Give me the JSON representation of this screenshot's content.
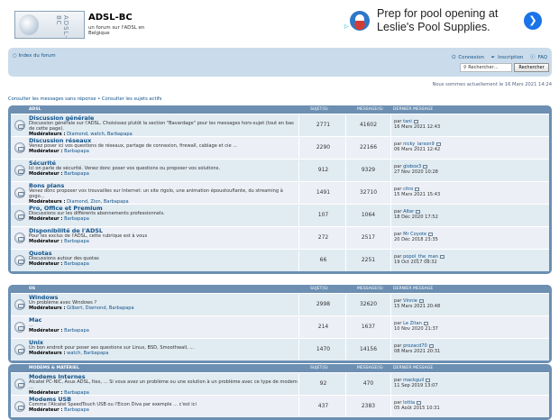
{
  "header": {
    "logo_text": "ADSL-BC",
    "site_title": "ADSL-BC",
    "site_desc": "un forum sur l'ADSL en Belgique"
  },
  "ad": {
    "text": "Prep for pool opening at Leslie's Pool Supplies.",
    "arrow_icon": "chevron-right-icon",
    "brand_color": "#1a73e8"
  },
  "nav": {
    "index": "Index du forum",
    "login": "Connexion",
    "register": "Inscription",
    "faq": "FAQ",
    "search_placeholder": "Rechercher…",
    "search_button": "Rechercher"
  },
  "datetime": "Nous sommes actuellement le 16 Mars 2021 14:24",
  "quicklinks": "Consulter les messages sans réponse • Consulter les sujets actifs",
  "columns": {
    "topics": "SUJET(S)",
    "posts": "MESSAGE(S)",
    "last": "DERNIER MESSAGE"
  },
  "categories": [
    {
      "name": "ADSL",
      "forums": [
        {
          "title": "Discussion générale",
          "desc": "Discussion générale sur l'ADSL. Choisissez plutôt la section \"Bavardage\" pour les messages hors-sujet (tout en bas de cette page).",
          "mods_label": "Modérateurs :",
          "mods": "Diamond, watch, Barbapapa",
          "topics": "2771",
          "posts": "41602",
          "last_by": "par",
          "last_user": "tani",
          "last_date": "16 Mars 2021 12:43"
        },
        {
          "title": "Discussion réseaux",
          "desc": "Venez poser ici vos questions de réseaux, partage de connexion, firewall, cablage et cie ...",
          "mods_label": "Modérateur :",
          "mods": "Barbapapa",
          "topics": "2290",
          "posts": "22166",
          "last_by": "par",
          "last_user": "nicky_larson9",
          "last_date": "06 Mars 2021 12:42"
        },
        {
          "title": "Sécurité",
          "desc": "Ici on parle de sécurité. Venez donc poser vos questions ou proposer vos solutions.",
          "mods_label": "Modérateur :",
          "mods": "Barbapapa",
          "topics": "912",
          "posts": "9329",
          "last_by": "par",
          "last_user": "globox3",
          "last_date": "27 Nov 2020 10:28"
        },
        {
          "title": "Bons plans",
          "desc": "Venez donc proposer vos trouvailles sur Internet: un site rigolo, une animation époustouflante, du streaming à gogo...",
          "mods_label": "Modérateurs :",
          "mods": "Diamond, Zion, Barbapapa",
          "topics": "1491",
          "posts": "32710",
          "last_by": "par",
          "last_user": "citro",
          "last_date": "15 Mars 2021 15:43"
        },
        {
          "title": "Pro, Office et Premium",
          "desc": "Discussions sur les différents abonnements professionnels.",
          "mods_label": "Modérateur :",
          "mods": "Barbapapa",
          "topics": "107",
          "posts": "1064",
          "last_by": "par",
          "last_user": "Alter",
          "last_date": "18 Déc 2020 17:52"
        },
        {
          "title": "Disponibilité de l'ADSL",
          "desc": "Pour les exclus de l'ADSL, cette rubrique est à vous",
          "mods_label": "Modérateur :",
          "mods": "Barbapapa",
          "topics": "272",
          "posts": "2517",
          "last_by": "par",
          "last_user": "Mr Coyote",
          "last_date": "20 Déc 2018 23:35"
        },
        {
          "title": "Quotas",
          "desc": "Discussions autour des quotas",
          "mods_label": "Modérateur :",
          "mods": "Barbapapa",
          "topics": "66",
          "posts": "2251",
          "last_by": "par",
          "last_user": "popol_the_man",
          "last_date": "19 Oct 2017 08:32"
        }
      ]
    },
    {
      "name": "OS",
      "forums": [
        {
          "title": "Windows",
          "desc": "Un problème avec Windows ?",
          "mods_label": "Modérateurs :",
          "mods": "Gilbert, Diamond, Barbapapa",
          "topics": "2998",
          "posts": "32620",
          "last_by": "par",
          "last_user": "Vinnie",
          "last_date": "15 Mars 2021 20:48"
        },
        {
          "title": "Mac",
          "desc": "...",
          "mods_label": "Modérateur :",
          "mods": "Barbapapa",
          "topics": "214",
          "posts": "1637",
          "last_by": "par",
          "last_user": "Le Zitan",
          "last_date": "10 Nov 2020 21:37"
        },
        {
          "title": "Unix",
          "desc": "Un bon endroit pour poser ses questions sur Linux, BSD, Smoothwall, ...",
          "mods_label": "Modérateurs :",
          "mods": "watch, Barbapapa",
          "topics": "1470",
          "posts": "14156",
          "last_by": "par",
          "last_user": "prozacd70",
          "last_date": "08 Mars 2021 20:31"
        }
      ]
    },
    {
      "name": "Modems & matériel",
      "forums": [
        {
          "title": "Modems Internes",
          "desc": "Alcatel PC-NIC, Asus ADSL, Itex, ... Si vous avez un problème ou une solution à un problème avec ce type de modem ...",
          "mods_label": "Modérateur :",
          "mods": "Barbapapa",
          "topics": "92",
          "posts": "470",
          "last_by": "par",
          "last_user": "mackguil",
          "last_date": "11 Sep 2019 13:07"
        },
        {
          "title": "Modems USB",
          "desc": "Comme l'Alcatel SpeedTouch USB ou l'Eicon Diva par exemple ... c'est ici",
          "mods_label": "Modérateur :",
          "mods": "Barbapapa",
          "topics": "437",
          "posts": "2383",
          "last_by": "par",
          "last_user": "lottia",
          "last_date": "05 Août 2015 10:31"
        }
      ]
    }
  ]
}
